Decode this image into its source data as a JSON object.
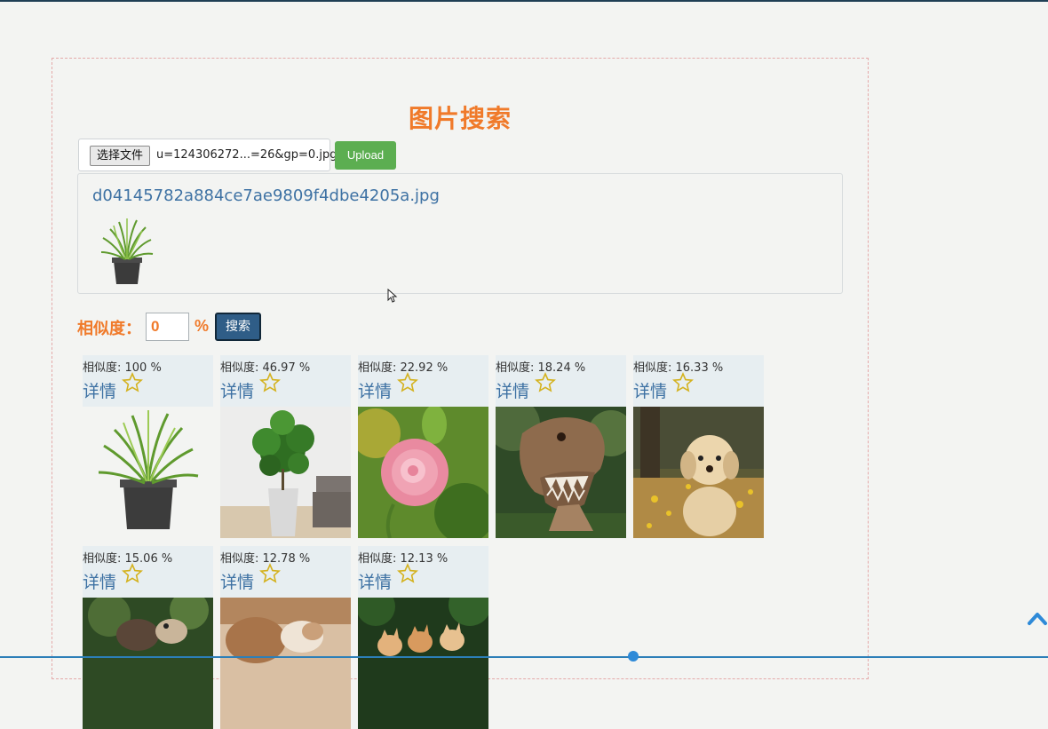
{
  "page": {
    "title": "图片搜索"
  },
  "upload": {
    "choose_file_label": "选择文件",
    "chosen_file_name": "u=124306272...=26&gp=0.jpg",
    "upload_label": "Upload"
  },
  "preview": {
    "uploaded_name": "d04145782a884ce7ae9809f4dbe4205a.jpg",
    "thumb_icon": "potted-grass-image"
  },
  "search": {
    "similarity_label": "相似度：",
    "similarity_value": "0",
    "percent_sign": "%",
    "search_label": "搜索"
  },
  "results": [
    {
      "score": "相似度: 100 %",
      "detail": "详情",
      "image": "potted-grass"
    },
    {
      "score": "相似度: 46.97 %",
      "detail": "详情",
      "image": "potted-plant-room"
    },
    {
      "score": "相似度: 22.92 %",
      "detail": "详情",
      "image": "pink-flower"
    },
    {
      "score": "相似度: 18.24 %",
      "detail": "详情",
      "image": "dinosaur"
    },
    {
      "score": "相似度: 16.33 %",
      "detail": "详情",
      "image": "puppy-field"
    },
    {
      "score": "相似度: 15.06 %",
      "detail": "详情",
      "image": "dogs-outdoor"
    },
    {
      "score": "相似度: 12.78 %",
      "detail": "详情",
      "image": "cat-dog"
    },
    {
      "score": "相似度: 12.13 %",
      "detail": "详情",
      "image": "kittens-grass"
    }
  ],
  "colors": {
    "accent_orange": "#f07a2a",
    "link_blue": "#3d71a3",
    "upload_green": "#5cae51",
    "search_navy": "#2f5d87",
    "star_gold": "#d4b21f"
  }
}
